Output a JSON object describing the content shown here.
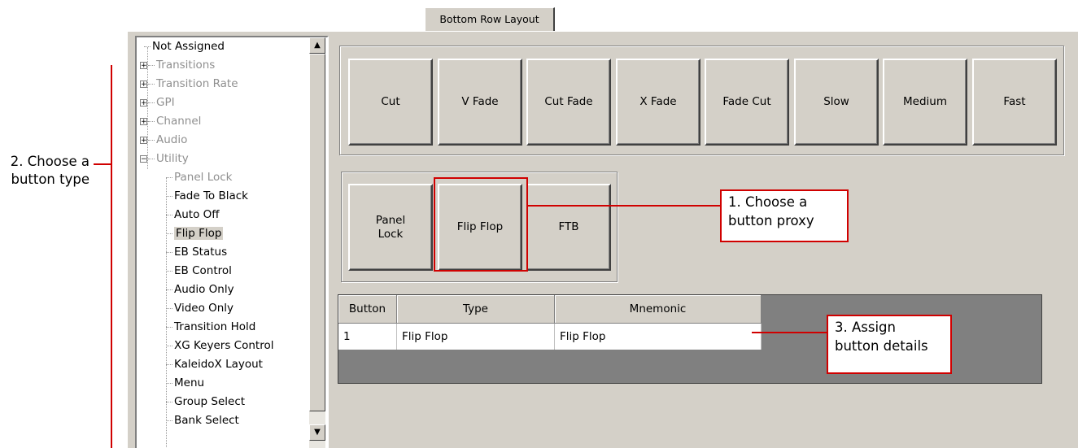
{
  "tab": {
    "label": "Bottom Row Layout"
  },
  "tree": {
    "items": [
      {
        "label": "Not Assigned"
      },
      {
        "label": "Transitions",
        "expander": "+"
      },
      {
        "label": "Transition Rate",
        "expander": "+"
      },
      {
        "label": "GPI",
        "expander": "+"
      },
      {
        "label": "Channel",
        "expander": "+"
      },
      {
        "label": "Audio",
        "expander": "+"
      },
      {
        "label": "Utility",
        "expander": "−"
      }
    ],
    "children": [
      {
        "label": "Panel Lock"
      },
      {
        "label": "Fade To Black"
      },
      {
        "label": "Auto Off"
      },
      {
        "label": "Flip Flop",
        "selected": true
      },
      {
        "label": "EB Status"
      },
      {
        "label": "EB Control"
      },
      {
        "label": "Audio Only"
      },
      {
        "label": "Video Only"
      },
      {
        "label": "Transition Hold"
      },
      {
        "label": "XG Keyers Control"
      },
      {
        "label": "KaleidoX Layout"
      },
      {
        "label": "Menu"
      },
      {
        "label": "Group Select"
      },
      {
        "label": "Bank Select"
      }
    ]
  },
  "transition_buttons": [
    "Cut",
    "V Fade",
    "Cut Fade",
    "X Fade",
    "Fade Cut",
    "Slow",
    "Medium",
    "Fast"
  ],
  "utility_buttons": [
    "Panel Lock",
    "Flip Flop",
    "FTB"
  ],
  "table": {
    "headers": [
      "Button",
      "Type",
      "Mnemonic"
    ],
    "rows": [
      [
        "1",
        "Flip Flop",
        "Flip Flop"
      ]
    ]
  },
  "annotations": {
    "step1": "1. Choose a button proxy",
    "step2": "2. Choose a button type",
    "step3": "3. Assign button details"
  },
  "colors": {
    "annotation_red": "#d00000",
    "panel_bg": "#d4d0c8"
  }
}
